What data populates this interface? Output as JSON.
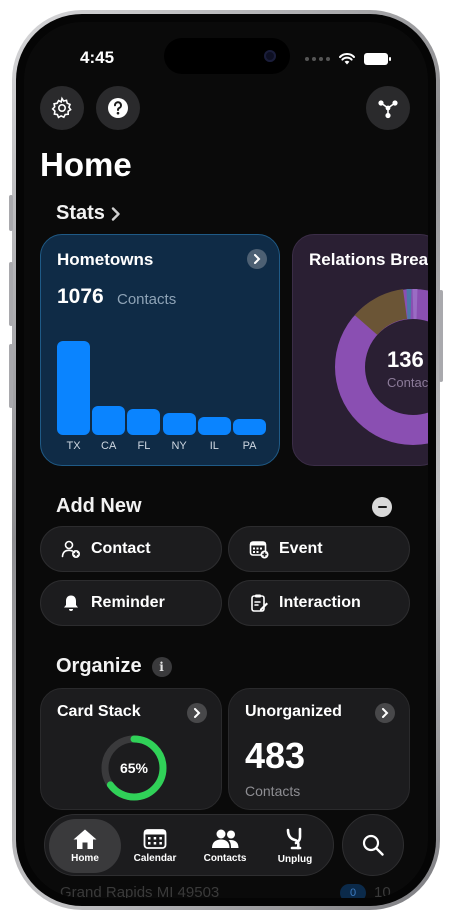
{
  "status": {
    "time": "4:45"
  },
  "page": {
    "title": "Home"
  },
  "stats": {
    "section_label": "Stats",
    "hometowns": {
      "title": "Hometowns",
      "count": "1076",
      "unit": "Contacts",
      "chart_data": {
        "type": "bar",
        "categories": [
          "TX",
          "CA",
          "FL",
          "NY",
          "IL",
          "PA"
        ],
        "values": [
          94,
          29,
          26,
          22,
          18,
          16
        ],
        "ylim": [
          0,
          100
        ]
      }
    },
    "relations": {
      "title": "Relations Breakdown",
      "count": "136",
      "unit": "Contacts",
      "colors": [
        "#8a4fb2",
        "#6b5536",
        "#4c78a8",
        "#9a6cc4"
      ]
    }
  },
  "add_new": {
    "section_label": "Add New",
    "buttons": [
      {
        "label": "Contact",
        "icon": "person-add-icon"
      },
      {
        "label": "Event",
        "icon": "calendar-add-icon"
      },
      {
        "label": "Reminder",
        "icon": "bell-icon"
      },
      {
        "label": "Interaction",
        "icon": "clipboard-edit-icon"
      }
    ]
  },
  "organize": {
    "section_label": "Organize",
    "card_stack": {
      "title": "Card Stack",
      "progress": "65%",
      "progress_value": 0.65
    },
    "unorganized": {
      "title": "Unorganized",
      "count": "483",
      "unit": "Contacts"
    }
  },
  "tabs": [
    {
      "label": "Home",
      "icon": "house-icon",
      "active": true
    },
    {
      "label": "Calendar",
      "icon": "calendar-icon",
      "active": false
    },
    {
      "label": "Contacts",
      "icon": "people-icon",
      "active": false
    },
    {
      "label": "Unplug",
      "icon": "unplug-icon",
      "active": false
    }
  ],
  "peek": {
    "text": "Grand Rapids MI 49503",
    "badge": "0",
    "num": "10"
  },
  "colors": {
    "accent": "#0a84ff",
    "progress": "#30d158",
    "background": "#0a0a0a"
  }
}
